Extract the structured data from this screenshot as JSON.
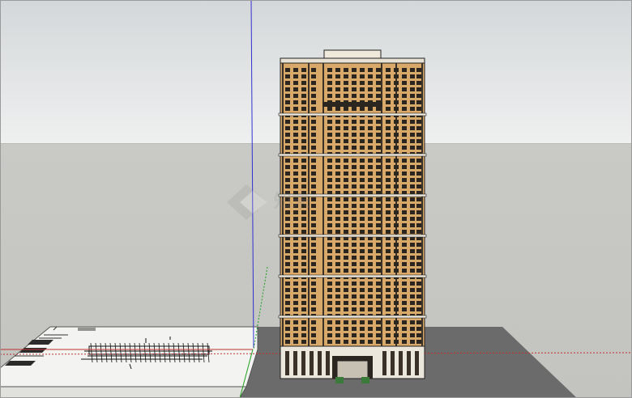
{
  "scene": {
    "sky_top": "#d4d7d9",
    "sky_bottom": "#eef0f0",
    "ground": "#c6c6c2",
    "ground_plane": "#6b6b6b",
    "facade_orange": "#d9a96a",
    "facade_dark": "#2c2620",
    "axis_blue": "#3030d0",
    "axis_red": "#c03030",
    "axis_green": "#20a020"
  },
  "icons": {
    "watermark": "diamond-logo-icon"
  }
}
